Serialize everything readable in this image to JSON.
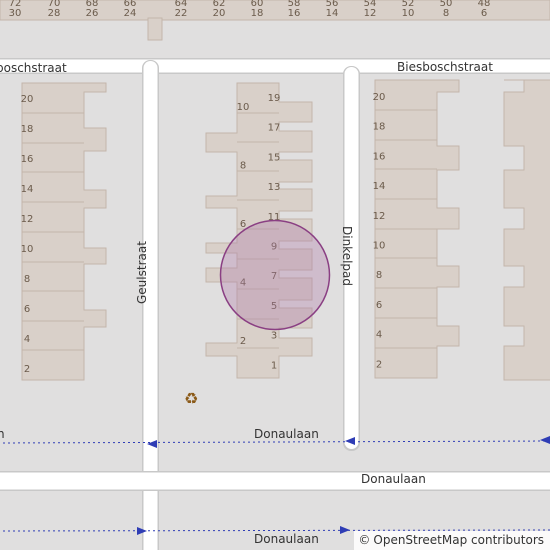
{
  "streets": {
    "biesbosch_left": "boschstraat",
    "biesbosch_right": "Biesboschstraat",
    "geul": "Geulstraat",
    "dinkel": "Dinkelpad",
    "donau_path_left": "n",
    "donau_path": "Donaulaan",
    "donau_road": "Donaulaan",
    "donau_bottom": "Donaulaan"
  },
  "top_numbers": [
    {
      "top": "72",
      "bottom": "30"
    },
    {
      "top": "70",
      "bottom": "28"
    },
    {
      "top": "68",
      "bottom": "26"
    },
    {
      "top": "66",
      "bottom": "24"
    },
    {
      "top": "64",
      "bottom": "22"
    },
    {
      "top": "62",
      "bottom": "20"
    },
    {
      "top": "60",
      "bottom": "18"
    },
    {
      "top": "58",
      "bottom": "16"
    },
    {
      "top": "56",
      "bottom": "14"
    },
    {
      "top": "54",
      "bottom": "12"
    },
    {
      "top": "52",
      "bottom": "10"
    },
    {
      "top": "50",
      "bottom": "8"
    },
    {
      "top": "48",
      "bottom": "6"
    }
  ],
  "left_block_numbers": [
    "20",
    "18",
    "16",
    "14",
    "12",
    "10",
    "8",
    "6",
    "4",
    "2"
  ],
  "middle_right_numbers": [
    "19",
    "17",
    "15",
    "13",
    "11",
    "9",
    "7",
    "5",
    "3",
    "1"
  ],
  "middle_left_numbers": [
    "10",
    "8",
    "6",
    "4",
    "2"
  ],
  "right_block_numbers": [
    "20",
    "18",
    "16",
    "14",
    "12",
    "10",
    "8",
    "6",
    "4",
    "2"
  ],
  "recycling_symbol": "♻",
  "colors": {
    "background": "#e0dfdf",
    "building": "#d9d0c9",
    "building_outline": "#c4b6ab",
    "road": "#ffffff",
    "road_casing": "#c8c8c8",
    "path": "#2f3db5",
    "marker_fill": "#b07aa8",
    "marker_stroke": "#8a3f83",
    "recycling": "#8b5a18"
  },
  "icons": {
    "recycling": "recycling-icon",
    "location": "location-marker-icon"
  },
  "attribution": {
    "symbol": "©",
    "text": "OpenStreetMap contributors"
  }
}
